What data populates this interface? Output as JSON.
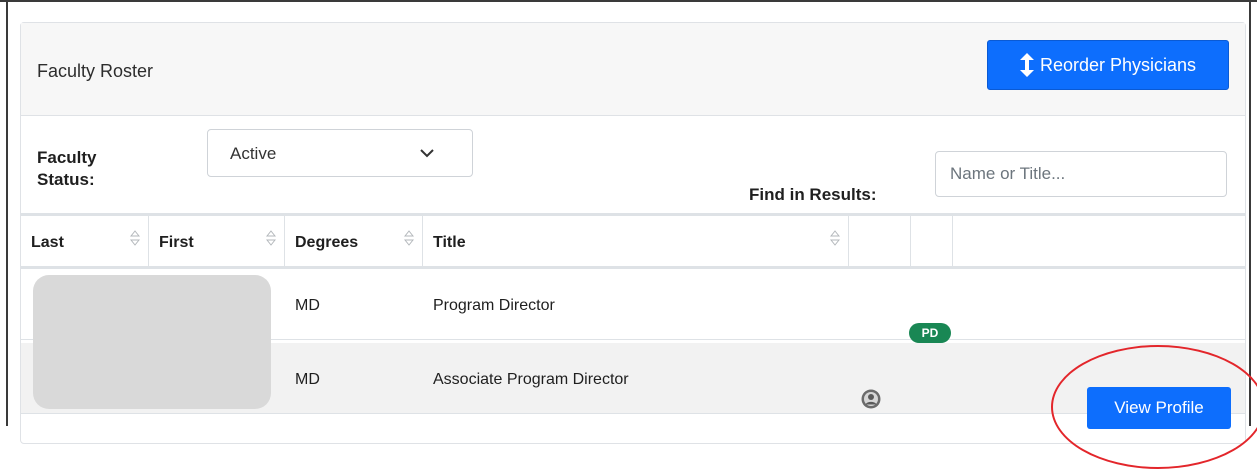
{
  "card": {
    "title": "Faculty Roster",
    "reorder_button": "Reorder Physicians"
  },
  "filters": {
    "status_label": "Faculty\nStatus:",
    "status_value": "Active",
    "find_label": "Find in Results:",
    "find_placeholder": "Name or Title..."
  },
  "table": {
    "columns": [
      "Last",
      "First",
      "Degrees",
      "Title",
      "",
      "",
      ""
    ],
    "rows": [
      {
        "last": "",
        "first": "",
        "degrees": "MD",
        "title": "Program Director",
        "badge": "PD",
        "action": ""
      },
      {
        "last": "",
        "first": "",
        "degrees": "MD",
        "title": "Associate Program Director",
        "badge": "",
        "action": "View Profile"
      }
    ]
  },
  "colors": {
    "primary": "#0d6efd",
    "badge_green": "#198754",
    "annotation_red": "#e3262b"
  },
  "icons": [
    "vertical-arrows-icon",
    "chevron-down-icon",
    "sort-icon",
    "avatar-icon"
  ]
}
